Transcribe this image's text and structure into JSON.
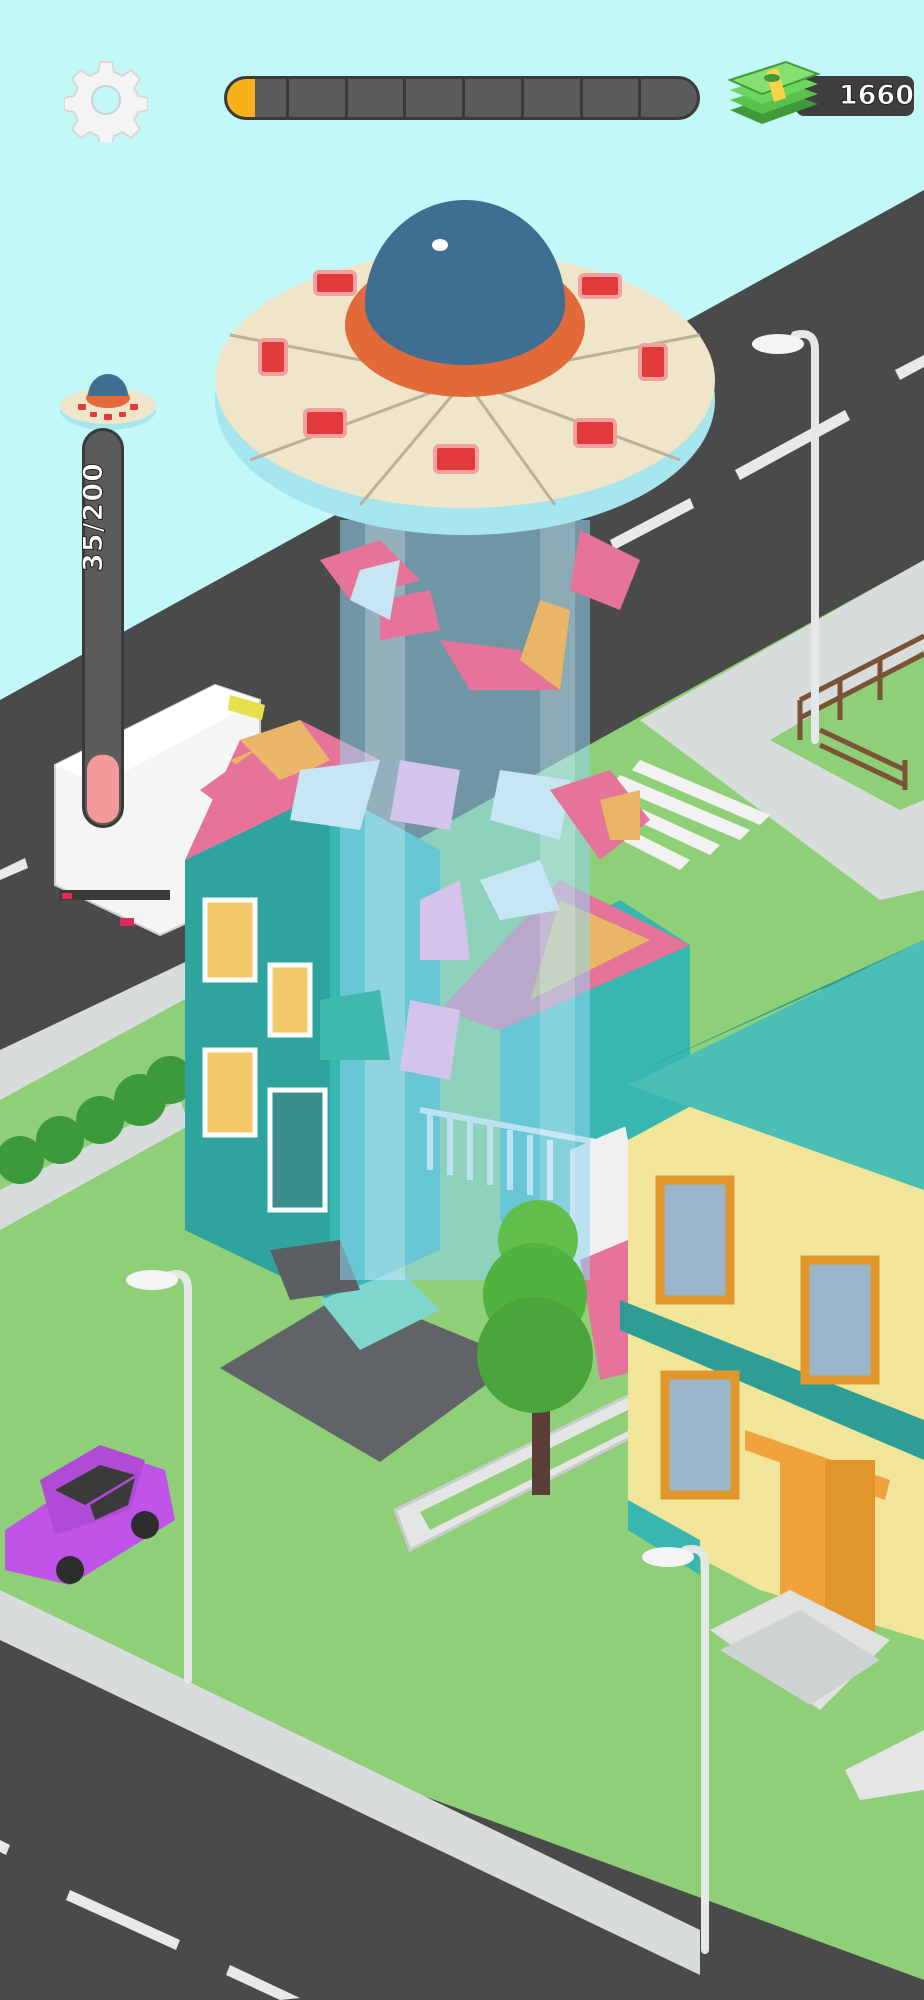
{
  "hud": {
    "settings_icon": "gear-icon",
    "level_progress": {
      "fraction": 0.05,
      "segments": 8,
      "fill_color": "#f8b11b",
      "track_color": "#5b5b5b"
    },
    "cash": {
      "icon": "cash-stack-icon",
      "amount": "1660"
    },
    "ufo_capacity": {
      "icon": "ufo-icon",
      "label": "35/200",
      "current": 35,
      "max": 200,
      "fill_color": "#f39a9a"
    }
  },
  "colors": {
    "sky": "#c3f8f8",
    "road": "#4a4a4a",
    "grass": "#8fcf78",
    "sidewalk": "#d9dcdc",
    "ufo_dome": "#3f6e93",
    "ufo_saucer": "#efe5c8",
    "beam": "#8fd6f3",
    "house_wall": "#38b7b0",
    "house_roof": "#e5739a",
    "yellow_house": "#f1e59a",
    "car": "#c053e8"
  },
  "scene": {
    "objects": [
      "ufo",
      "tractor-beam",
      "destroyed-house",
      "yellow-house",
      "white-truck",
      "purple-car",
      "tree",
      "street-lamps",
      "hedge",
      "fence"
    ]
  }
}
